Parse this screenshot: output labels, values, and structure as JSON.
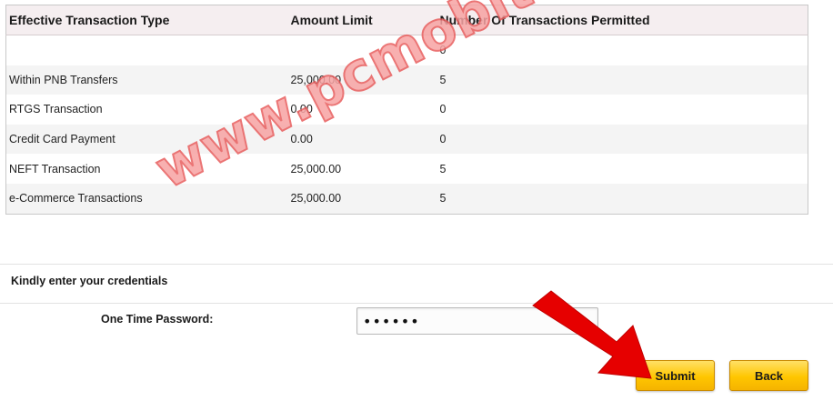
{
  "table": {
    "headers": [
      "Effective Transaction Type",
      "Amount Limit",
      "Number Of Transactions Permitted"
    ],
    "rows": [
      {
        "type": "",
        "amount": "",
        "count": "0"
      },
      {
        "type": "Within PNB Transfers",
        "amount": "25,000.00",
        "count": "5"
      },
      {
        "type": "RTGS Transaction",
        "amount": "0.00",
        "count": "0"
      },
      {
        "type": "Credit Card Payment",
        "amount": "0.00",
        "count": "0"
      },
      {
        "type": "NEFT Transaction",
        "amount": "25,000.00",
        "count": "5"
      },
      {
        "type": "e-Commerce Transactions",
        "amount": "25,000.00",
        "count": "5"
      }
    ]
  },
  "credentials": {
    "heading": "Kindly enter your credentials",
    "otp_label": "One Time Password:",
    "otp_value": "••••••"
  },
  "buttons": {
    "submit": "Submit",
    "back": "Back"
  },
  "watermark": "www.pcmobitech.com",
  "colors": {
    "button_fill": "#ffc600",
    "header_bg": "#f5eef0",
    "watermark": "#f7a3a3",
    "arrow": "#e60000"
  }
}
